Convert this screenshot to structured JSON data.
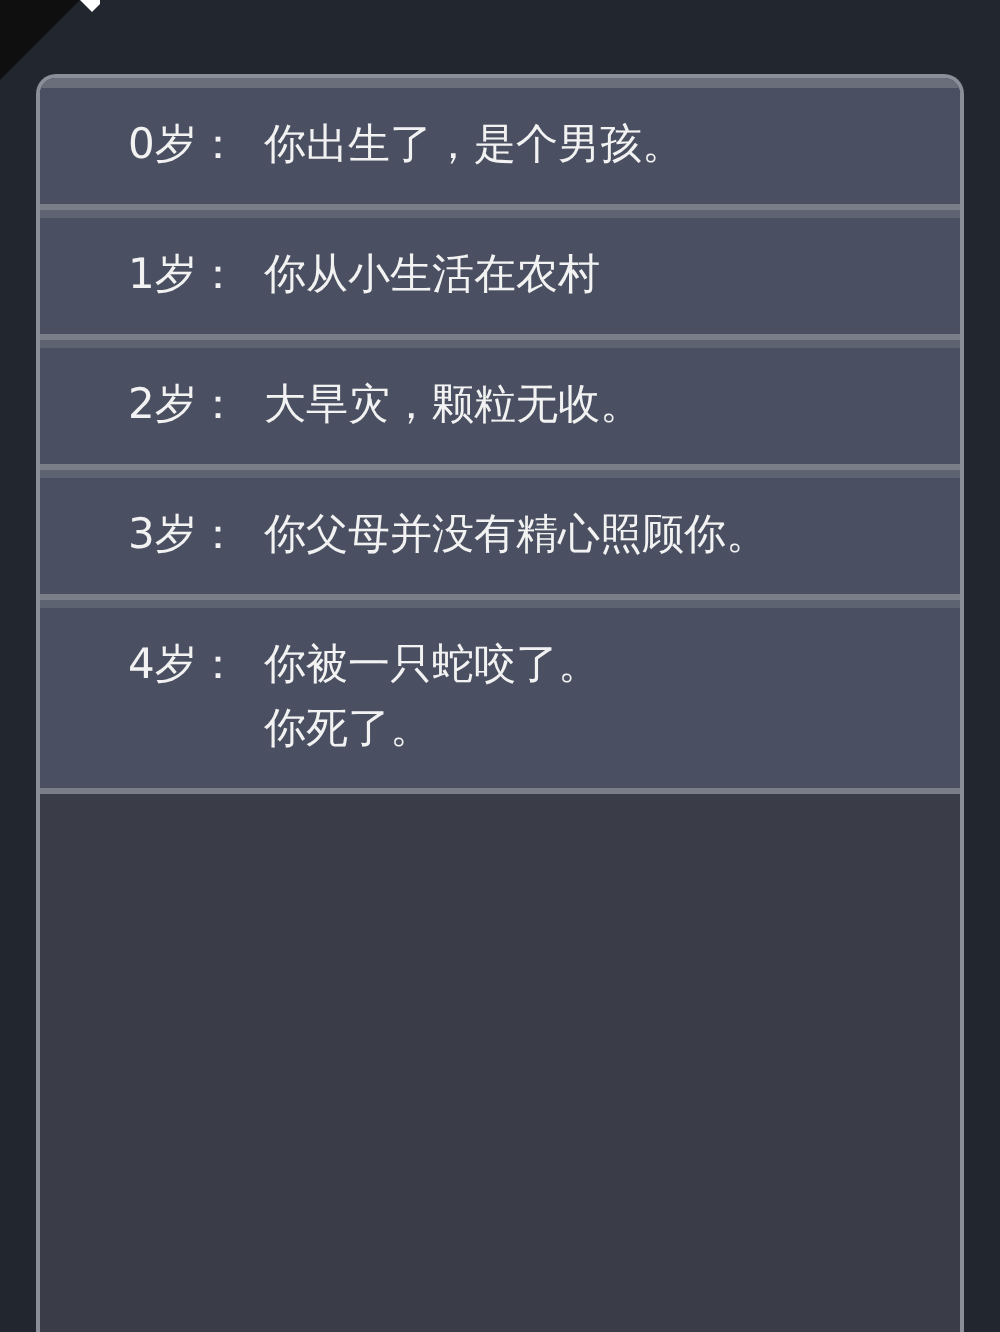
{
  "log": [
    {
      "age": "0岁：",
      "events": [
        "你出生了，是个男孩。"
      ]
    },
    {
      "age": "1岁：",
      "events": [
        "你从小生活在农村"
      ]
    },
    {
      "age": "2岁：",
      "events": [
        "大旱灾，颗粒无收。"
      ]
    },
    {
      "age": "3岁：",
      "events": [
        "你父母并没有精心照顾你。"
      ]
    },
    {
      "age": "4岁：",
      "events": [
        "你被一只蛇咬了。",
        "你死了。"
      ]
    }
  ]
}
